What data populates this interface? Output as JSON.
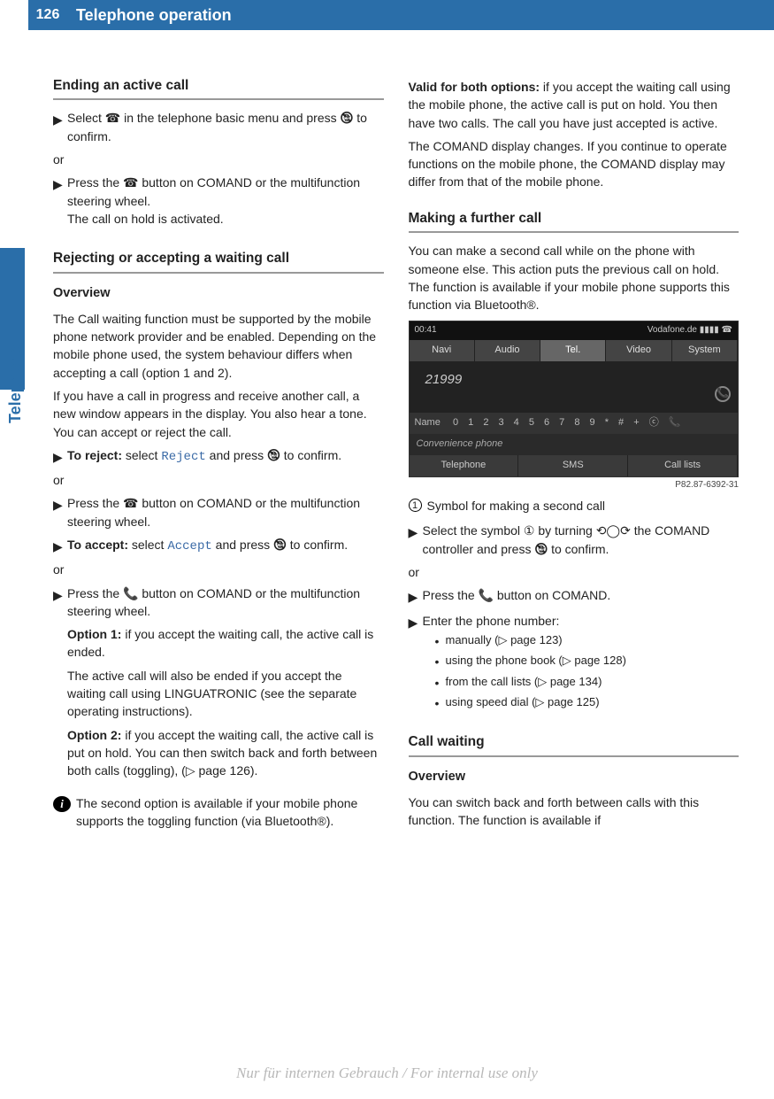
{
  "header": {
    "page": "126",
    "chapter": "Telephone operation",
    "side": "Telephone"
  },
  "left": {
    "h_ending": "Ending an active call",
    "end_step": "Select ☎ in the telephone basic menu and press 🕲 to confirm.",
    "or": "or",
    "end_step2a": "Press the ☎ button on COMAND or the multifunction steering wheel.",
    "end_step2b": "The call on hold is activated.",
    "h_reject": "Rejecting or accepting a waiting call",
    "overview": "Overview",
    "overview_p1": "The Call waiting function must be supported by the mobile phone network provider and be enabled. Depending on the mobile phone used, the system behaviour differs when accepting a call (option 1 and 2).",
    "overview_p2": "If you have a call in progress and receive another call, a new window appears in the display. You also hear a tone. You can accept or reject the call.",
    "reject_label": "To reject:",
    "reject_text": " select ",
    "reject_ui": "Reject",
    "reject_text2": " and press 🕲 to confirm.",
    "reject_alt": "Press the ☎ button on COMAND or the multifunction steering wheel.",
    "accept_label": "To accept:",
    "accept_text": " select ",
    "accept_ui": "Accept",
    "accept_text2": " and press 🕲 to confirm.",
    "accept_alt": "Press the 📞 button on COMAND or the multifunction steering wheel.",
    "opt1_label": "Option 1:",
    "opt1_text": " if you accept the waiting call, the active call is ended.",
    "opt1_p2": "The active call will also be ended if you accept the waiting call using LINGUATRONIC (see the separate operating instructions).",
    "opt2_label": "Option 2:",
    "opt2_text": " if you accept the waiting call, the active call is put on hold. You can then switch back and forth between both calls (toggling), (▷ page 126).",
    "info1": "The second option is available if your mobile phone supports the toggling function (via Bluetooth®)."
  },
  "right": {
    "valid_label": "Valid for both options:",
    "valid_text": " if you accept the waiting call using the mobile phone, the active call is put on hold. You then have two calls. The call you have just accepted is active.",
    "valid_p2": "The COMAND display changes. If you continue to operate functions on the mobile phone, the COMAND display may differ from that of the mobile phone.",
    "h_further": "Making a further call",
    "further_p": "You can make a second call while on the phone with someone else. This action puts the previous call on hold. The function is available if your mobile phone supports this function via Bluetooth®.",
    "screenshot": {
      "time": "00:41",
      "carrier": "Vodafone.de ▮▮▮▮ ☎",
      "tabs": [
        "Navi",
        "Audio",
        "Tel.",
        "Video",
        "System"
      ],
      "number": "21999",
      "call2": "①",
      "name_label": "Name",
      "name_chars": "0 1 2 3 4 5 6 7 8 9 * # + ⓒ 📞",
      "conv": "Convenience phone",
      "bottom": [
        "Telephone",
        "SMS",
        "Call lists"
      ]
    },
    "img_code": "P82.87-6392-31",
    "legend1": "Symbol for making a second call",
    "sel_step": "Select the symbol ① by turning ⟲◯⟳ the COMAND controller and press 🕲 to confirm.",
    "press_step": "Press the 📞 button on COMAND.",
    "enter_step": "Enter the phone number:",
    "bullets": [
      "manually (▷ page 123)",
      "using the phone book (▷ page 128)",
      "from the call lists (▷ page 134)",
      "using speed dial (▷ page 125)"
    ],
    "h_callwait": "Call waiting",
    "cw_overview": "Overview",
    "cw_p": "You can switch back and forth between calls with this function. The function is available if"
  },
  "watermark": "Nur für internen Gebrauch / For internal use only"
}
